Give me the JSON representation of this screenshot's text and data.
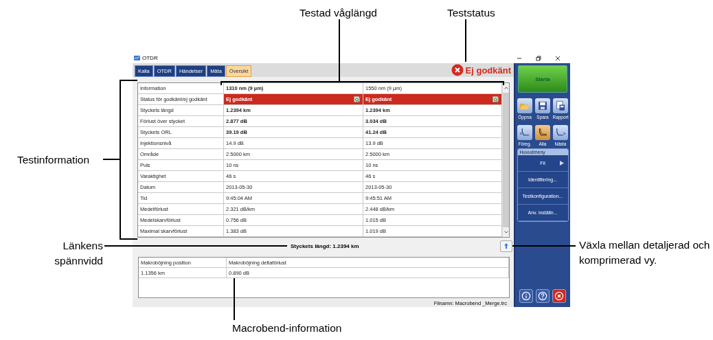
{
  "window": {
    "title": "OTDR"
  },
  "tabs": [
    {
      "label": "Kalla",
      "selected": false
    },
    {
      "label": "OTDR",
      "selected": false
    },
    {
      "label": "Händelser",
      "selected": false
    },
    {
      "label": "Mäta",
      "selected": false
    },
    {
      "label": "Översikt",
      "selected": true
    }
  ],
  "test_status": {
    "label": "Ej godkänt",
    "passed": false
  },
  "table": {
    "header": "Information",
    "wavelengths": [
      {
        "label": "1310 nm (9 µm)",
        "selected": true
      },
      {
        "label": "1550 nm (9 µm)",
        "selected": false
      }
    ],
    "rows": [
      {
        "label": "Status för godkänt/ej godkänt",
        "kind": "status",
        "values": [
          "Ej godkänt",
          "Ej godkänt"
        ]
      },
      {
        "label": "Styckets längd",
        "kind": "bold",
        "values": [
          "1.2394 km",
          "1.2394 km"
        ]
      },
      {
        "label": "Förlust över stycket",
        "kind": "bold",
        "values": [
          "2.877 dB",
          "3.034 dB"
        ]
      },
      {
        "label": "Styckets ORL",
        "kind": "bold",
        "values": [
          "39.19 dB",
          "41.24 dB"
        ]
      },
      {
        "label": "Injektionsnivå",
        "kind": "plain",
        "values": [
          "14.9 dB",
          "13.9 dB"
        ]
      },
      {
        "label": "Område",
        "kind": "plain",
        "values": [
          "2.5000 km",
          "2.5000 km"
        ]
      },
      {
        "label": "Puls",
        "kind": "plain",
        "values": [
          "10 ns",
          "10 ns"
        ]
      },
      {
        "label": "Varaktighet",
        "kind": "plain",
        "values": [
          "46 s",
          "46 s"
        ]
      },
      {
        "label": "Datum",
        "kind": "plain",
        "values": [
          "2013-05-30",
          "2013-05-30"
        ]
      },
      {
        "label": "Tid",
        "kind": "plain",
        "values": [
          "9:45:04 AM",
          "9:45:51 AM"
        ]
      },
      {
        "label": "Medelförlust",
        "kind": "plain",
        "values": [
          "2.321 dB/km",
          "2.448 dB/km"
        ]
      },
      {
        "label": "Medelskarvförlust",
        "kind": "plain",
        "values": [
          "0.756 dB",
          "1.015 dB"
        ]
      },
      {
        "label": "Maximal skarvförlust",
        "kind": "plain",
        "values": [
          "1.383 dB",
          "1.019 dB"
        ]
      }
    ]
  },
  "span_length": "Styckets längd: 1.2394 km",
  "macrobend": {
    "columns": [
      "Makroböjning position",
      "Makroböjning deltaförlust"
    ],
    "rows": [
      [
        "1.1356 km",
        "0.890 dB"
      ]
    ]
  },
  "status_bar": "Filnamn: Macrobend _Merge.trc",
  "sidebar": {
    "start": "Starta",
    "file_buttons": [
      {
        "label": "Öppna",
        "kind": "open"
      },
      {
        "label": "Spara",
        "kind": "save"
      },
      {
        "label": "Rapport",
        "kind": "report"
      }
    ],
    "trace_buttons": [
      {
        "label": "Föreg.",
        "kind": "prev",
        "selected": false
      },
      {
        "label": "Alla",
        "kind": "all",
        "selected": true
      },
      {
        "label": "Nästa",
        "kind": "next",
        "selected": false
      }
    ],
    "menu": {
      "title": "Huvudmeny",
      "items": [
        {
          "label": "Fil",
          "submenu": true
        },
        {
          "label": "Identifiering...",
          "submenu": false
        },
        {
          "label": "Testkonfiguration...",
          "submenu": false
        },
        {
          "label": "Anv. inställn...",
          "submenu": false
        }
      ]
    },
    "bottom_buttons": [
      {
        "kind": "info"
      },
      {
        "kind": "help"
      },
      {
        "kind": "exit"
      }
    ]
  },
  "callouts": [
    "Testad våglängd",
    "Teststatus",
    "Testinformation",
    "Länkens spännvidd",
    "Växla mellan detaljerad och komprimerad vy.",
    "Macrobend-information"
  ]
}
